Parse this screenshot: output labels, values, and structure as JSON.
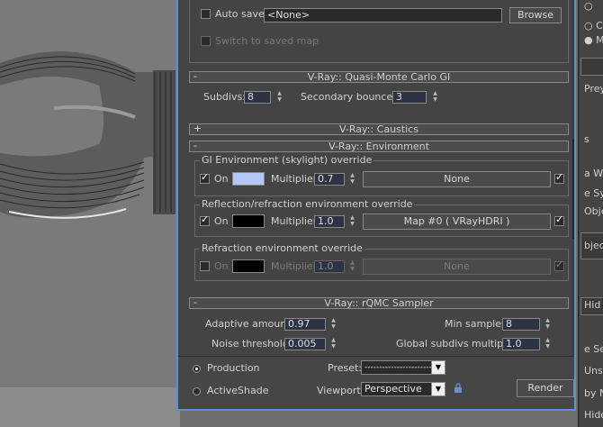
{
  "global_switches": {
    "autosave_label": "Auto save:",
    "autosave_value": "<None>",
    "browse_label": "Browse",
    "switch_saved_map_label": "Switch to saved map"
  },
  "qmc_gi": {
    "title": "V-Ray:: Quasi-Monte Carlo GI",
    "toggle": "-",
    "subdivs_label": "Subdivs:",
    "subdivs_value": "8",
    "bounces_label": "Secondary bounces:",
    "bounces_value": "3"
  },
  "caustics": {
    "title": "V-Ray:: Caustics",
    "toggle": "+"
  },
  "environment": {
    "title": "V-Ray:: Environment",
    "toggle": "-",
    "gi": {
      "group_label": "GI Environment (skylight) override",
      "on_label": "On",
      "on_checked": true,
      "swatch_color": "#b4c8f5",
      "multiplier_label": "Multiplier:",
      "multiplier_value": "0.7",
      "map_label": "None",
      "map_checked": true
    },
    "reflection": {
      "group_label": "Reflection/refraction environment override",
      "on_label": "On",
      "on_checked": true,
      "swatch_color": "#000000",
      "multiplier_label": "Multiplier:",
      "multiplier_value": "1.0",
      "map_label": "Map #0  ( VRayHDRI )",
      "map_checked": true
    },
    "refraction": {
      "group_label": "Refraction environment override",
      "on_label": "On",
      "on_checked": false,
      "swatch_color": "#000000",
      "multiplier_label": "Multiplier:",
      "multiplier_value": "1.0",
      "map_label": "None",
      "map_checked": true
    }
  },
  "rqmc": {
    "title": "V-Ray:: rQMC Sampler",
    "toggle": "-",
    "adaptive_label": "Adaptive amount:",
    "adaptive_value": "0.97",
    "noise_label": "Noise threshold:",
    "noise_value": "0.005",
    "min_samples_label": "Min samples:",
    "min_samples_value": "8",
    "global_subdivs_label": "Global subdivs multiplier:",
    "global_subdivs_value": "1.0"
  },
  "bottom": {
    "production_label": "Production",
    "activeshade_label": "ActiveShade",
    "preset_label": "Preset:",
    "preset_value": "----------------------------",
    "viewport_label": "Viewport:",
    "viewport_value": "Perspective",
    "render_label": "Render"
  },
  "right_panel": [
    "Prey",
    "s",
    "a W",
    "e Sy",
    "Obje",
    "bjec",
    "Hid",
    "e Se",
    "Uns",
    "by N",
    "Hide b"
  ]
}
